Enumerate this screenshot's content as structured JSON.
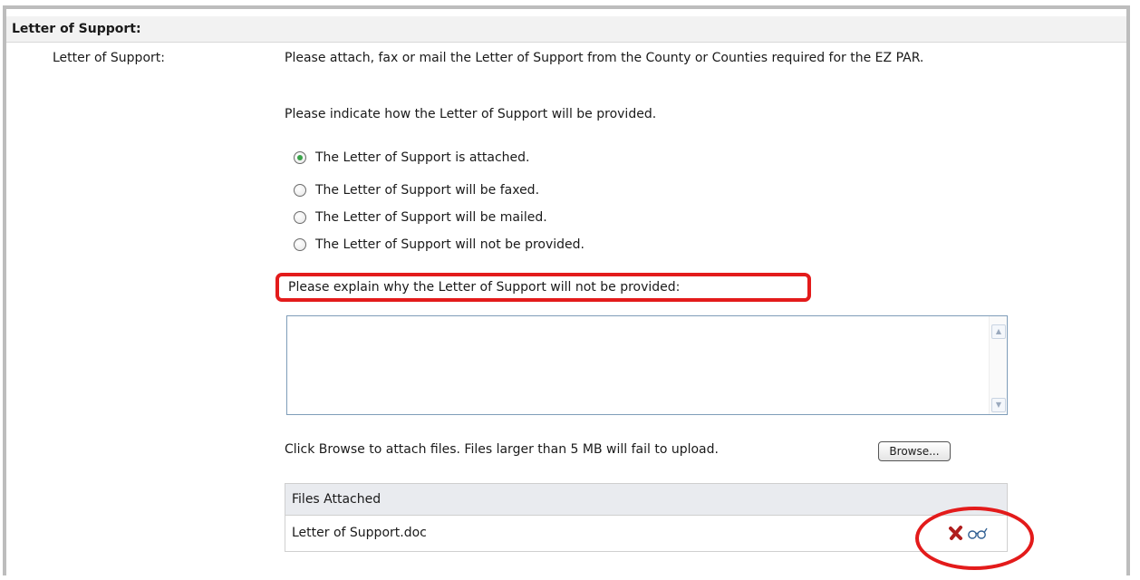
{
  "section": {
    "title": "Letter of Support:"
  },
  "field": {
    "label": "Letter of Support:",
    "description": "Please attach, fax or mail the Letter of Support from the County or Counties required for the EZ PAR.",
    "indicate": "Please indicate how the Letter of Support will be provided."
  },
  "options": [
    {
      "label": "The Letter of Support is attached.",
      "selected": true
    },
    {
      "label": "The Letter of Support will be faxed.",
      "selected": false
    },
    {
      "label": "The Letter of Support will be mailed.",
      "selected": false
    },
    {
      "label": "The Letter of Support will not be provided.",
      "selected": false
    }
  ],
  "explain": {
    "label": "Please explain why the Letter of Support will not be provided:",
    "value": ""
  },
  "upload": {
    "instruction": "Click Browse to attach files.  Files larger than 5 MB will fail to upload.",
    "browse_label": "Browse..."
  },
  "files": {
    "header": "Files Attached",
    "items": [
      {
        "name": "Letter of Support.doc"
      }
    ]
  },
  "colors": {
    "highlight": "#e31b1b",
    "radio_selected": "#3aa34a",
    "delete_icon": "#b01e1e"
  },
  "icons": {
    "delete": "x-delete-icon",
    "view": "eyeglasses-view-icon"
  }
}
